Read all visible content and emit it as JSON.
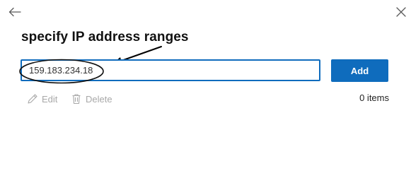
{
  "header": {
    "back_icon": "back-arrow-icon",
    "close_icon": "close-icon"
  },
  "annotation": {
    "title": "specify IP address ranges"
  },
  "ip_input": {
    "value": "159.183.234.18"
  },
  "add_button": {
    "label": "Add"
  },
  "toolbar": {
    "edit_label": "Edit",
    "edit_icon": "pencil-icon",
    "delete_label": "Delete",
    "delete_icon": "trash-icon",
    "count_label": "0 items"
  },
  "colors": {
    "accent": "#0f6cbd",
    "disabled_text": "#a8a8a8"
  }
}
